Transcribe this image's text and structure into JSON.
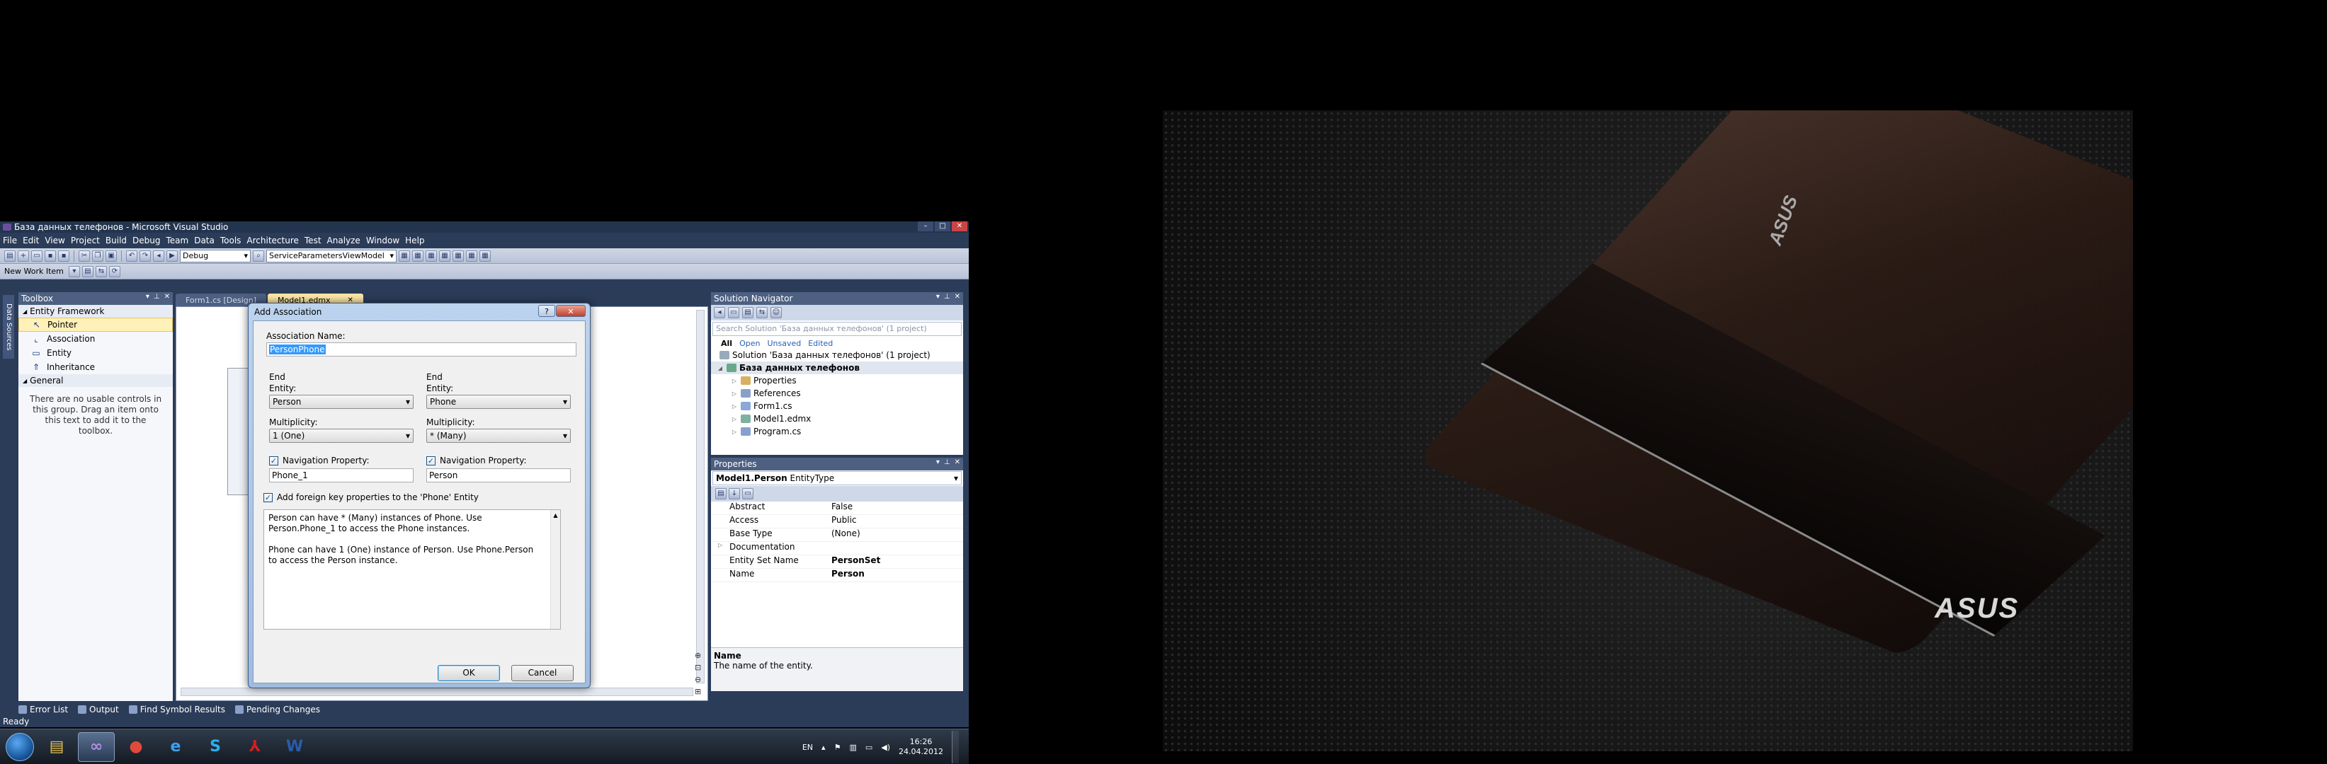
{
  "window": {
    "title": "База данных телефонов - Microsoft Visual Studio",
    "menu": [
      "File",
      "Edit",
      "View",
      "Project",
      "Build",
      "Debug",
      "Team",
      "Data",
      "Tools",
      "Architecture",
      "Test",
      "Analyze",
      "Window",
      "Help"
    ],
    "config_combo": "Debug",
    "startup_combo": "ServiceParametersViewModel",
    "new_work_item": "New Work Item"
  },
  "side_tab": "Data Sources",
  "toolbox": {
    "title": "Toolbox",
    "group1": "Entity Framework",
    "items": [
      {
        "label": "Pointer",
        "icon": "pointer-icon",
        "glyph": "↖"
      },
      {
        "label": "Association",
        "icon": "association-icon",
        "glyph": "⌞"
      },
      {
        "label": "Entity",
        "icon": "entity-icon",
        "glyph": "▭"
      },
      {
        "label": "Inheritance",
        "icon": "inheritance-icon",
        "glyph": "⇑"
      }
    ],
    "group2": "General",
    "note": "There are no usable controls in this group. Drag an item onto this text to add it to the toolbox."
  },
  "doc_tabs": [
    {
      "label": "Form1.cs [Design]",
      "active": false
    },
    {
      "label": "Model1.edmx",
      "active": true
    }
  ],
  "dialog": {
    "title": "Add Association",
    "assoc_name_label": "Association Name:",
    "assoc_name_value": "PersonPhone",
    "end_label": "End",
    "entity_label": "Entity:",
    "multiplicity_label": "Multiplicity:",
    "navprop_label": "Navigation Property:",
    "left": {
      "entity": "Person",
      "multiplicity": "1 (One)",
      "navprop": "Phone_1"
    },
    "right": {
      "entity": "Phone",
      "multiplicity": "* (Many)",
      "navprop": "Person"
    },
    "fk_checkbox": "Add foreign key properties to the 'Phone' Entity",
    "desc1": "Person can have * (Many) instances of Phone. Use Person.Phone_1 to access the Phone instances.",
    "desc2": "Phone can have 1 (One) instance of Person. Use Phone.Person to access the Person instance.",
    "ok": "OK",
    "cancel": "Cancel"
  },
  "solution_navigator": {
    "title": "Solution Navigator",
    "search_placeholder": "Search Solution 'База данных телефонов' (1 project)",
    "filters": [
      "All",
      "Open",
      "Unsaved",
      "Edited"
    ],
    "root": "Solution 'База данных телефонов' (1 project)",
    "project": "База данных телефонов",
    "items": [
      "Properties",
      "References",
      "Form1.cs",
      "Model1.edmx",
      "Program.cs"
    ]
  },
  "properties": {
    "title": "Properties",
    "object": "Model1.Person",
    "object_type": "EntityType",
    "rows": [
      {
        "k": "Abstract",
        "v": "False",
        "bold": false
      },
      {
        "k": "Access",
        "v": "Public",
        "bold": false
      },
      {
        "k": "Base Type",
        "v": "(None)",
        "bold": false
      },
      {
        "k": "Documentation",
        "v": "",
        "bold": false,
        "expand": true
      },
      {
        "k": "Entity Set Name",
        "v": "PersonSet",
        "bold": true
      },
      {
        "k": "Name",
        "v": "Person",
        "bold": true
      }
    ],
    "desc_title": "Name",
    "desc_text": "The name of the entity."
  },
  "bottom_tabs": [
    "Error List",
    "Output",
    "Find Symbol Results",
    "Pending Changes"
  ],
  "status": "Ready",
  "taskbar": {
    "lang": "EN",
    "time": "16:26",
    "date": "24.04.2012",
    "apps": [
      {
        "name": "explorer",
        "glyph": "▤",
        "color": "#e8c050"
      },
      {
        "name": "visual-studio",
        "glyph": "∞",
        "color": "#b090e0"
      },
      {
        "name": "chrome",
        "glyph": "●",
        "color": "#e04a3a"
      },
      {
        "name": "internet-explorer",
        "glyph": "e",
        "color": "#3aa0f0"
      },
      {
        "name": "skype",
        "glyph": "S",
        "color": "#2ab0ef"
      },
      {
        "name": "adobe-reader",
        "glyph": "⅄",
        "color": "#d02020"
      },
      {
        "name": "word",
        "glyph": "W",
        "color": "#2a5caa"
      }
    ]
  },
  "wallpaper": {
    "brand": "ASUS",
    "lid_brand": "ASUS"
  }
}
